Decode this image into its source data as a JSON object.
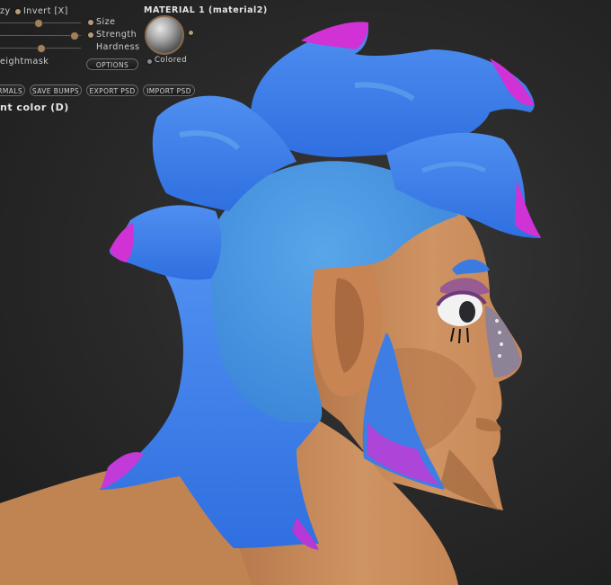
{
  "toolbar": {
    "invert_label": "Invert [X]",
    "lazy_fragment": "zy",
    "size_label": "Size",
    "strength_label": "Strength",
    "hardness_label": "Hardness",
    "weightmask_fragment": "eightmask",
    "options_button": "OPTIONS",
    "normals_button": "ORMALS",
    "save_bumps_button": "SAVE BUMPS",
    "export_psd_button": "EXPORT PSD",
    "import_psd_button": "IMPORT PSD",
    "paint_color_fragment": "nt color (D)"
  },
  "material": {
    "title": "MATERIAL 1 (material2)",
    "colored_label": "Colored"
  },
  "colors": {
    "background": "#2a2a2a",
    "hair_blue": "#3d7ee6",
    "hair_light": "#4a9ae8",
    "hair_magenta": "#d02fd8",
    "skin": "#c98a5c",
    "skin_shadow": "#a56a42",
    "nose_grey": "#8c8090",
    "panel_accent": "#b89978"
  },
  "viewport": {
    "subject": "3d-sculpt-head-blue-mohawk"
  }
}
